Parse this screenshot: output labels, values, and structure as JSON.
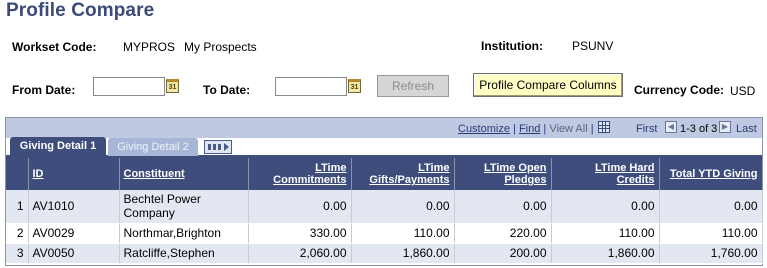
{
  "page": {
    "title": "Profile Compare"
  },
  "header": {
    "workset_label": "Workset Code:",
    "workset_code": "MYPROS",
    "workset_desc": "My Prospects",
    "institution_label": "Institution:",
    "institution_value": "PSUNV",
    "from_date_label": "From Date:",
    "from_date_value": "",
    "to_date_label": "To Date:",
    "to_date_value": "",
    "calendar_icon_text": "31",
    "refresh_label": "Refresh",
    "profile_compare_columns_label": "Profile Compare Columns",
    "currency_label": "Currency Code:",
    "currency_value": "USD"
  },
  "grid": {
    "nav": {
      "customize": "Customize",
      "sep": "|",
      "find": "Find",
      "view_all": "View All",
      "first": "First",
      "range": "1-3 of 3",
      "last": "Last"
    },
    "tabs": [
      {
        "label": "Giving Detail 1",
        "active": true
      },
      {
        "label": "Giving Detail 2",
        "active": false
      }
    ],
    "columns": [
      "ID",
      "Constituent",
      "LTime Commitments",
      "LTime Gifts/Payments",
      "LTime Open Pledges",
      "LTime Hard Credits",
      "Total YTD Giving"
    ],
    "rows": [
      {
        "n": "1",
        "id": "AV1010",
        "constituent": "Bechtel Power Company",
        "commitments": "0.00",
        "gifts": "0.00",
        "pledges": "0.00",
        "credits": "0.00",
        "ytd": "0.00"
      },
      {
        "n": "2",
        "id": "AV0029",
        "constituent": "Northmar,Brighton",
        "commitments": "330.00",
        "gifts": "110.00",
        "pledges": "220.00",
        "credits": "110.00",
        "ytd": "110.00"
      },
      {
        "n": "3",
        "id": "AV0050",
        "constituent": "Ratcliffe,Stephen",
        "commitments": "2,060.00",
        "gifts": "1,860.00",
        "pledges": "200.00",
        "credits": "1,860.00",
        "ytd": "1,760.00"
      }
    ]
  }
}
